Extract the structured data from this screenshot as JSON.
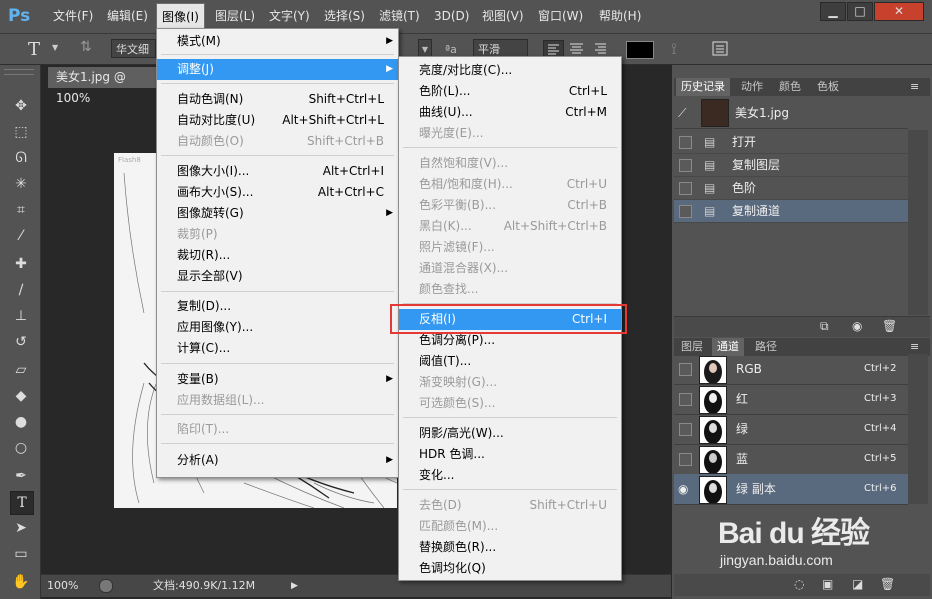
{
  "app": {
    "logo": "Ps"
  },
  "menubar": [
    "文件(F)",
    "编辑(E)",
    "图像(I)",
    "图层(L)",
    "文字(Y)",
    "选择(S)",
    "滤镜(T)",
    "3D(D)",
    "视图(V)",
    "窗口(W)",
    "帮助(H)"
  ],
  "window_controls": [
    "▁",
    "□",
    "✕"
  ],
  "options": {
    "font": "华文细",
    "antialias": "平滑",
    "aa_icon": "ªa"
  },
  "document": {
    "tab": "美女1.jpg @ 100%",
    "canvas_text": "Flash8"
  },
  "status": {
    "zoom": "100%",
    "doc": "文档:490.9K/1.12M"
  },
  "image_menu": {
    "items": [
      {
        "label": "模式(M)",
        "shortcut": "",
        "sub": true,
        "dis": false
      },
      {
        "label": "调整(J)",
        "shortcut": "",
        "sub": true,
        "dis": false
      },
      {
        "label": "自动色调(N)",
        "shortcut": "Shift+Ctrl+L",
        "dis": false
      },
      {
        "label": "自动对比度(U)",
        "shortcut": "Alt+Shift+Ctrl+L",
        "dis": false
      },
      {
        "label": "自动颜色(O)",
        "shortcut": "Shift+Ctrl+B",
        "dis": true
      },
      {
        "label": "图像大小(I)...",
        "shortcut": "Alt+Ctrl+I",
        "dis": false
      },
      {
        "label": "画布大小(S)...",
        "shortcut": "Alt+Ctrl+C",
        "dis": false
      },
      {
        "label": "图像旋转(G)",
        "shortcut": "",
        "sub": true,
        "dis": false
      },
      {
        "label": "裁剪(P)",
        "shortcut": "",
        "dis": true
      },
      {
        "label": "裁切(R)...",
        "shortcut": "",
        "dis": false
      },
      {
        "label": "显示全部(V)",
        "shortcut": "",
        "dis": false
      },
      {
        "label": "复制(D)...",
        "shortcut": "",
        "dis": false
      },
      {
        "label": "应用图像(Y)...",
        "shortcut": "",
        "dis": false
      },
      {
        "label": "计算(C)...",
        "shortcut": "",
        "dis": false
      },
      {
        "label": "变量(B)",
        "shortcut": "",
        "sub": true,
        "dis": false
      },
      {
        "label": "应用数据组(L)...",
        "shortcut": "",
        "dis": true
      },
      {
        "label": "陷印(T)...",
        "shortcut": "",
        "dis": true
      },
      {
        "label": "分析(A)",
        "shortcut": "",
        "sub": true,
        "dis": false
      }
    ]
  },
  "adjust_menu": {
    "items": [
      {
        "label": "亮度/对比度(C)...",
        "shortcut": "",
        "dis": false
      },
      {
        "label": "色阶(L)...",
        "shortcut": "Ctrl+L",
        "dis": false
      },
      {
        "label": "曲线(U)...",
        "shortcut": "Ctrl+M",
        "dis": false
      },
      {
        "label": "曝光度(E)...",
        "shortcut": "",
        "dis": true
      },
      {
        "label": "自然饱和度(V)...",
        "shortcut": "",
        "dis": true
      },
      {
        "label": "色相/饱和度(H)...",
        "shortcut": "Ctrl+U",
        "dis": true
      },
      {
        "label": "色彩平衡(B)...",
        "shortcut": "Ctrl+B",
        "dis": true
      },
      {
        "label": "黑白(K)...",
        "shortcut": "Alt+Shift+Ctrl+B",
        "dis": true
      },
      {
        "label": "照片滤镜(F)...",
        "shortcut": "",
        "dis": true
      },
      {
        "label": "通道混合器(X)...",
        "shortcut": "",
        "dis": true
      },
      {
        "label": "颜色查找...",
        "shortcut": "",
        "dis": true
      },
      {
        "label": "反相(I)",
        "shortcut": "Ctrl+I",
        "dis": false
      },
      {
        "label": "色调分离(P)...",
        "shortcut": "",
        "dis": false
      },
      {
        "label": "阈值(T)...",
        "shortcut": "",
        "dis": false
      },
      {
        "label": "渐变映射(G)...",
        "shortcut": "",
        "dis": true
      },
      {
        "label": "可选颜色(S)...",
        "shortcut": "",
        "dis": true
      },
      {
        "label": "阴影/高光(W)...",
        "shortcut": "",
        "dis": false
      },
      {
        "label": "HDR 色调...",
        "shortcut": "",
        "dis": false
      },
      {
        "label": "变化...",
        "shortcut": "",
        "dis": false
      },
      {
        "label": "去色(D)",
        "shortcut": "Shift+Ctrl+U",
        "dis": true
      },
      {
        "label": "匹配颜色(M)...",
        "shortcut": "",
        "dis": true
      },
      {
        "label": "替换颜色(R)...",
        "shortcut": "",
        "dis": false
      },
      {
        "label": "色调均化(Q)",
        "shortcut": "",
        "dis": false
      }
    ]
  },
  "history_panel": {
    "tabs": [
      "历史记录",
      "动作",
      "颜色",
      "色板"
    ],
    "snapshot": "美女1.jpg",
    "items": [
      "打开",
      "复制图层",
      "色阶",
      "复制通道"
    ]
  },
  "channels_panel": {
    "tabs": [
      "图层",
      "通道",
      "路径"
    ],
    "items": [
      {
        "name": "RGB",
        "shortcut": "Ctrl+2"
      },
      {
        "name": "红",
        "shortcut": "Ctrl+3"
      },
      {
        "name": "绿",
        "shortcut": "Ctrl+4"
      },
      {
        "name": "蓝",
        "shortcut": "Ctrl+5"
      },
      {
        "name": "绿 副本",
        "shortcut": "Ctrl+6"
      }
    ]
  },
  "watermark": {
    "brand": "Bai du 经验",
    "url": "jingyan.baidu.com"
  },
  "colors": {
    "highlight": "#3298f2",
    "annotation": "#e53935",
    "panel": "#535353"
  }
}
